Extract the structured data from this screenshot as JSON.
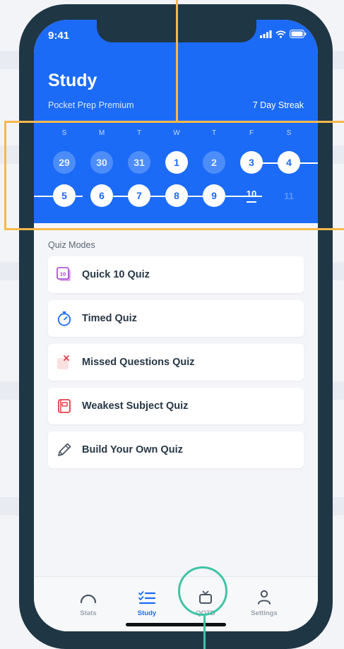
{
  "status": {
    "time": "9:41"
  },
  "header": {
    "title": "Study",
    "subtitle": "Pocket Prep Premium",
    "streak": "7 Day Streak"
  },
  "calendar": {
    "weekdays": [
      "S",
      "M",
      "T",
      "W",
      "T",
      "F",
      "S"
    ],
    "week1": [
      {
        "day": "29",
        "state": "past"
      },
      {
        "day": "30",
        "state": "past"
      },
      {
        "day": "31",
        "state": "past"
      },
      {
        "day": "1",
        "state": "done"
      },
      {
        "day": "2",
        "state": "past"
      },
      {
        "day": "3",
        "state": "done"
      },
      {
        "day": "4",
        "state": "done"
      }
    ],
    "week2": [
      {
        "day": "5",
        "state": "done"
      },
      {
        "day": "6",
        "state": "done"
      },
      {
        "day": "7",
        "state": "done"
      },
      {
        "day": "8",
        "state": "done"
      },
      {
        "day": "9",
        "state": "done"
      },
      {
        "day": "10",
        "state": "today"
      },
      {
        "day": "11",
        "state": "future"
      }
    ]
  },
  "quiz_modes": {
    "label": "Quiz Modes",
    "items": [
      {
        "label": "Quick 10 Quiz",
        "icon": "quick-10-icon"
      },
      {
        "label": "Timed Quiz",
        "icon": "stopwatch-icon"
      },
      {
        "label": "Missed Questions Quiz",
        "icon": "missed-x-icon"
      },
      {
        "label": "Weakest Subject Quiz",
        "icon": "notebook-icon"
      },
      {
        "label": "Build Your Own Quiz",
        "icon": "pencil-icon"
      }
    ]
  },
  "tabbar": {
    "stats": "Stats",
    "study": "Study",
    "qotd": "QOTD",
    "settings": "Settings",
    "active": "study"
  },
  "colors": {
    "primary": "#1c6bf7",
    "phone_frame": "#1f3645",
    "highlight_orange": "#f7b84b",
    "highlight_teal": "#3fc4a5"
  }
}
